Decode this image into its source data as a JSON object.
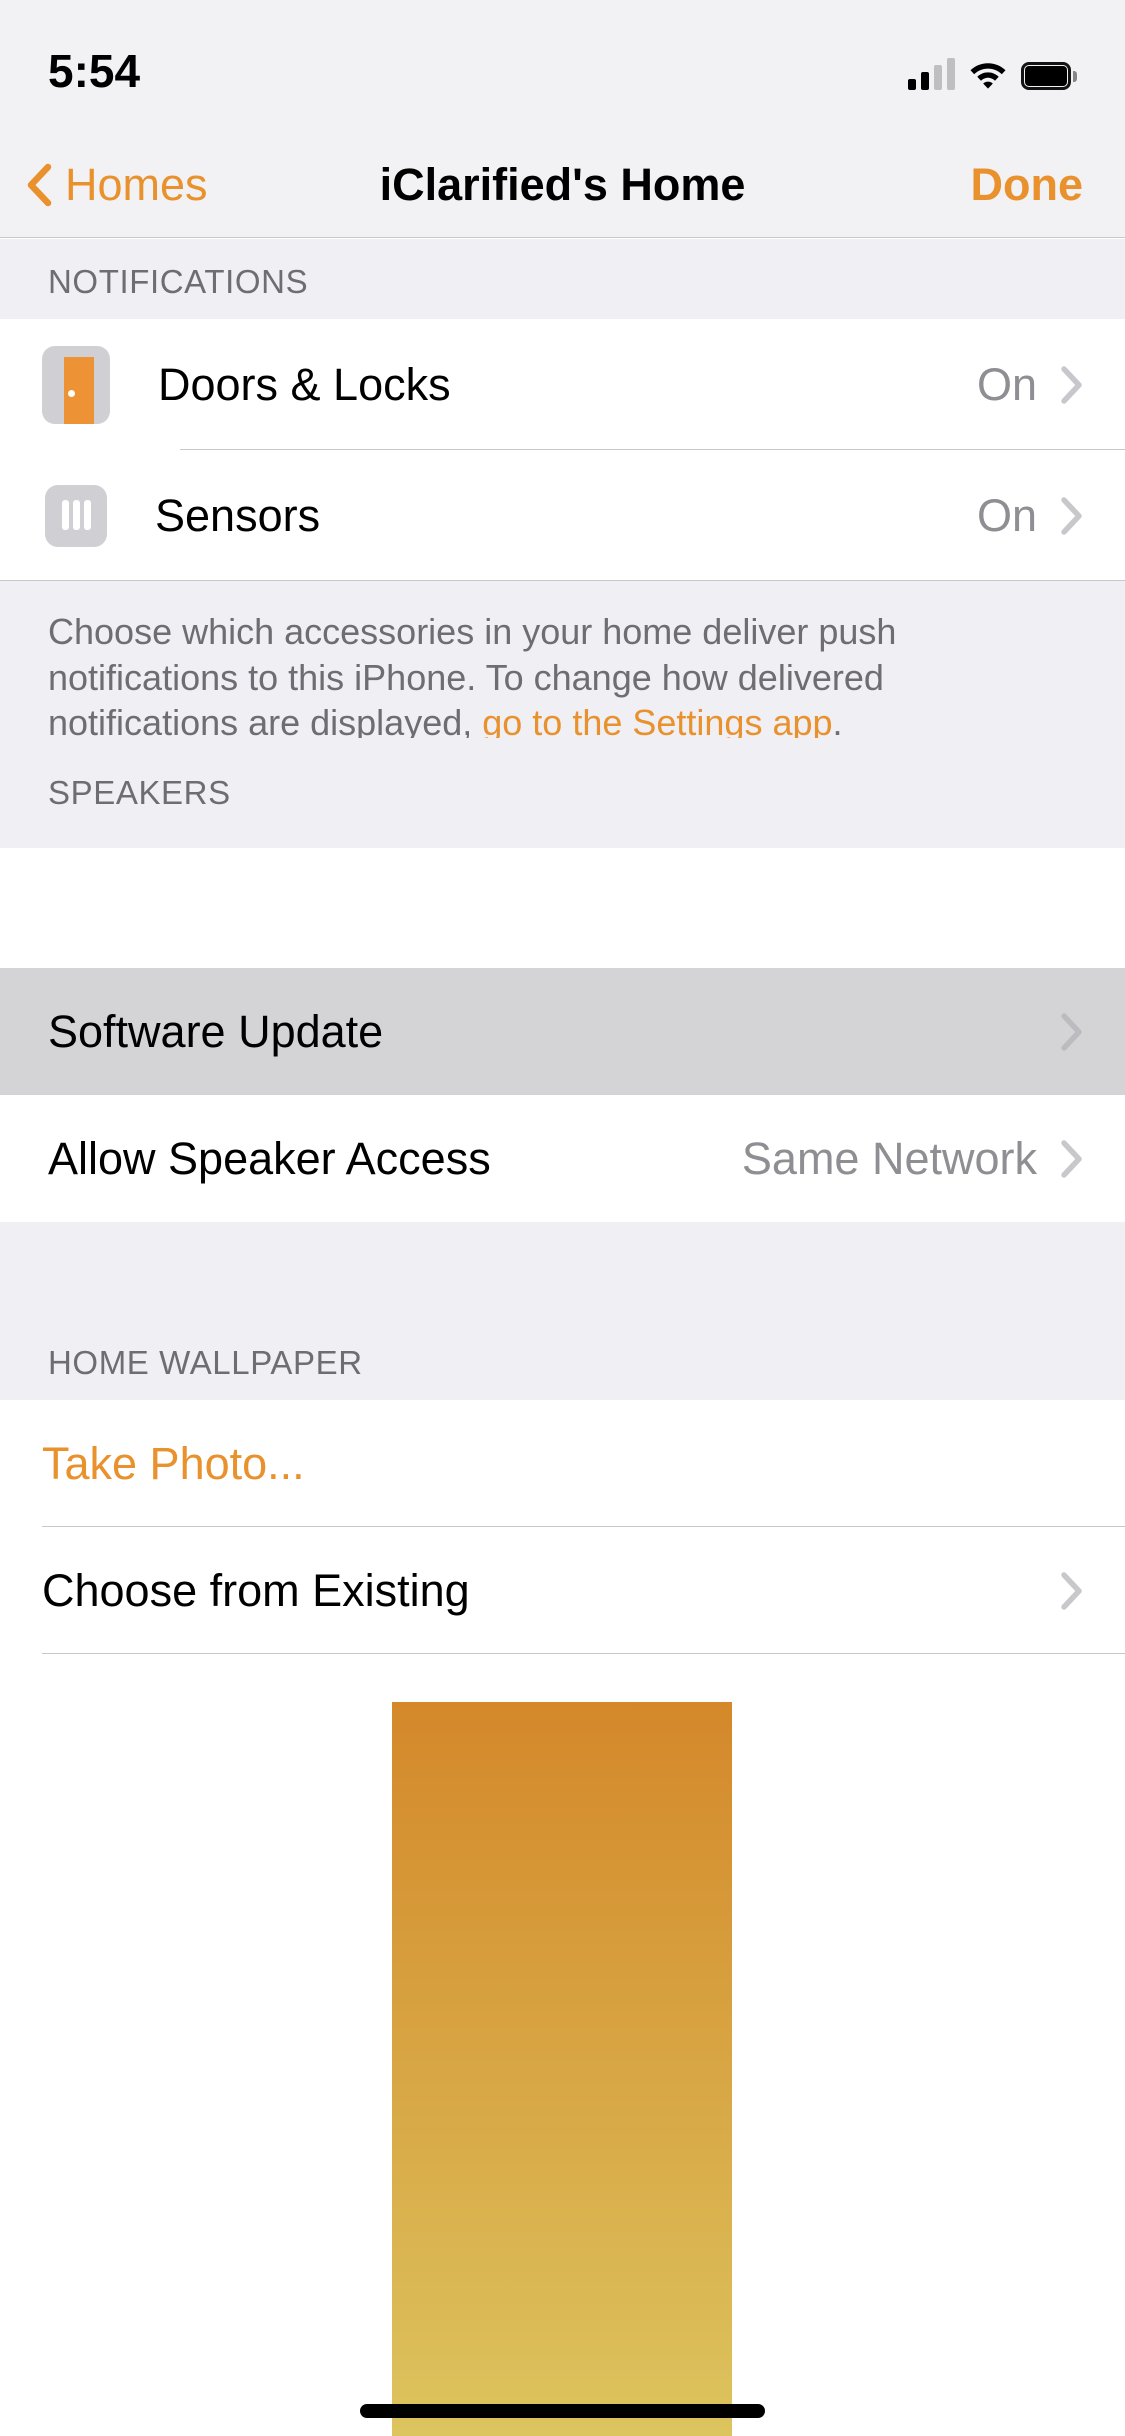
{
  "status_bar": {
    "time": "5:54",
    "cellular_icon": "cellular-signal-icon",
    "cellular_bars_filled": 2,
    "cellular_bars_total": 4,
    "wifi_icon": "wifi-icon",
    "battery_icon": "battery-full-icon"
  },
  "nav": {
    "back_icon": "chevron-left-icon",
    "back_label": "Homes",
    "title": "iClarified's Home",
    "done_label": "Done"
  },
  "sections": {
    "notifications": {
      "header": "NOTIFICATIONS",
      "rows": [
        {
          "icon": "door-icon",
          "label": "Doors & Locks",
          "value": "On",
          "chevron": "chevron-right-icon"
        },
        {
          "icon": "sensor-icon",
          "label": "Sensors",
          "value": "On",
          "chevron": "chevron-right-icon"
        }
      ],
      "note_part1": "Choose which accessories in your home deliver push notifications to this iPhone. To change how delivered notifications are displayed, ",
      "note_link": "go to the Settings app",
      "note_part2": "."
    },
    "speakers": {
      "header": "SPEAKERS",
      "rows": [
        {
          "label": "Software Update",
          "value": "",
          "chevron": "chevron-right-icon",
          "pressed": true
        },
        {
          "label": "Allow Speaker Access",
          "value": "Same Network",
          "chevron": "chevron-right-icon",
          "pressed": false
        }
      ]
    },
    "home_wallpaper": {
      "header": "HOME WALLPAPER",
      "rows": [
        {
          "label": "Take Photo...",
          "accent": true,
          "chevron": ""
        },
        {
          "label": "Choose from Existing",
          "accent": false,
          "chevron": "chevron-right-icon"
        }
      ],
      "preview_top_color": "#D4882A",
      "preview_bottom_color": "#DCC45E"
    }
  },
  "colors": {
    "accent": "#E8912D",
    "group_background": "#EFEFF4",
    "separator": "#C8C7CC",
    "secondary_text": "#8E8E93",
    "pressed_row": "#D4D4D6"
  },
  "home_indicator": "home-indicator"
}
